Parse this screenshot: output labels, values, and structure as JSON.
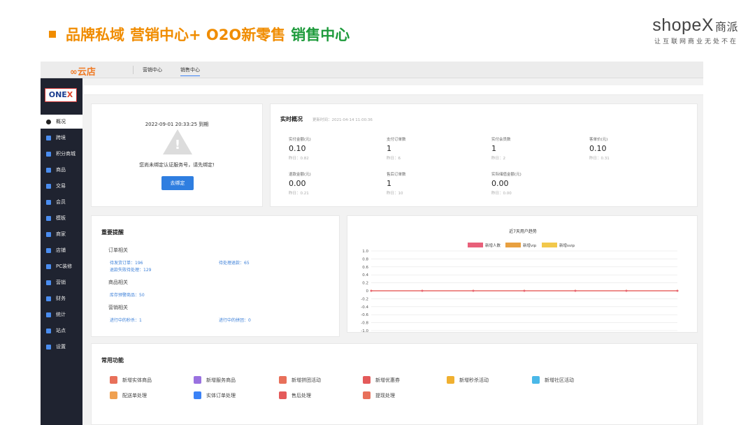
{
  "slide": {
    "title_part1": "品牌私域",
    "title_part2": "营销中心+ O2O新零售",
    "title_part3": "销售中心"
  },
  "brand": {
    "main": "shopeX",
    "cn": "商派",
    "slogan": "让互联网商业无处不在"
  },
  "topbar": {
    "logo": "云店",
    "nav": [
      "营销中心",
      "销售中心"
    ],
    "active": "销售中心"
  },
  "sidebar": {
    "logo": "ONEX",
    "items": [
      "概况",
      "跨境",
      "积分商城",
      "商品",
      "交易",
      "会员",
      "模板",
      "商家",
      "店铺",
      "PC装修",
      "营销",
      "财务",
      "统计",
      "站点",
      "设置"
    ]
  },
  "binding": {
    "expire": "2022-09-01 20:33:25 到期",
    "message": "您尚未绑定认证服务号，请先绑定!",
    "button": "去绑定"
  },
  "realtime": {
    "title": "实时概况",
    "update_time": "更新时间：2021-04-14 11:00:36",
    "metrics": [
      {
        "label": "实付金额(元)",
        "value": "0.10",
        "yesterday": "昨日：0.82"
      },
      {
        "label": "支付订单数",
        "value": "1",
        "yesterday": "昨日：6"
      },
      {
        "label": "实付会员数",
        "value": "1",
        "yesterday": "昨日：2"
      },
      {
        "label": "客单价(元)",
        "value": "0.10",
        "yesterday": "昨日：0.31"
      },
      {
        "label": "退款金额(元)",
        "value": "0.00",
        "yesterday": "昨日：0.21"
      },
      {
        "label": "售后订单数",
        "value": "1",
        "yesterday": "昨日：10"
      },
      {
        "label": "实际储值金额(元)",
        "value": "0.00",
        "yesterday": "昨日：0.00"
      }
    ]
  },
  "reminders": {
    "title": "重要提醒",
    "order_section": "订单相关",
    "order_pending_ship": "待发货订单：196",
    "order_pending_refund": "待处理退款：65",
    "order_refund_failed": "退款失败待处理：129",
    "goods_section": "商品相关",
    "goods_stock_alert": "库存预警商品：50",
    "marketing_section": "营销相关",
    "marketing_seckill": "进行中的秒杀：1",
    "marketing_group": "进行中的拼团：0"
  },
  "chart_data": {
    "type": "line",
    "title": "近7天用户趋势",
    "series": [
      {
        "name": "新增人数",
        "color": "#e8607a",
        "values": [
          0,
          0,
          0,
          0,
          0,
          0,
          0
        ]
      },
      {
        "name": "新增vip",
        "color": "#e8a040",
        "values": [
          0,
          0,
          0,
          0,
          0,
          0,
          0
        ]
      },
      {
        "name": "新增svip",
        "color": "#f2c84b",
        "values": [
          0,
          0,
          0,
          0,
          0,
          0,
          0
        ]
      }
    ],
    "ylim": [
      -1.0,
      1.0
    ],
    "yticks": [
      "1.0",
      "0.8",
      "0.6",
      "0.4",
      "0.2",
      "0",
      "-0.2",
      "-0.4",
      "-0.6",
      "-0.8",
      "-1.0"
    ],
    "grid": true,
    "legend": "top-center"
  },
  "functions": {
    "title": "常用功能",
    "items": [
      {
        "label": "新增实体商品",
        "color": "#e8705a"
      },
      {
        "label": "新增服务商品",
        "color": "#9a72e0"
      },
      {
        "label": "新增拼团活动",
        "color": "#e8705a"
      },
      {
        "label": "新增优惠券",
        "color": "#e45a5a"
      },
      {
        "label": "新增秒杀活动",
        "color": "#f0b030"
      },
      {
        "label": "新增社区活动",
        "color": "#4ab8e8"
      },
      {
        "label": "配送单处理",
        "color": "#f0a050"
      },
      {
        "label": "实体订单处理",
        "color": "#3b82f6"
      },
      {
        "label": "售后处理",
        "color": "#e45a5a"
      },
      {
        "label": "提现处理",
        "color": "#e8705a"
      }
    ]
  }
}
